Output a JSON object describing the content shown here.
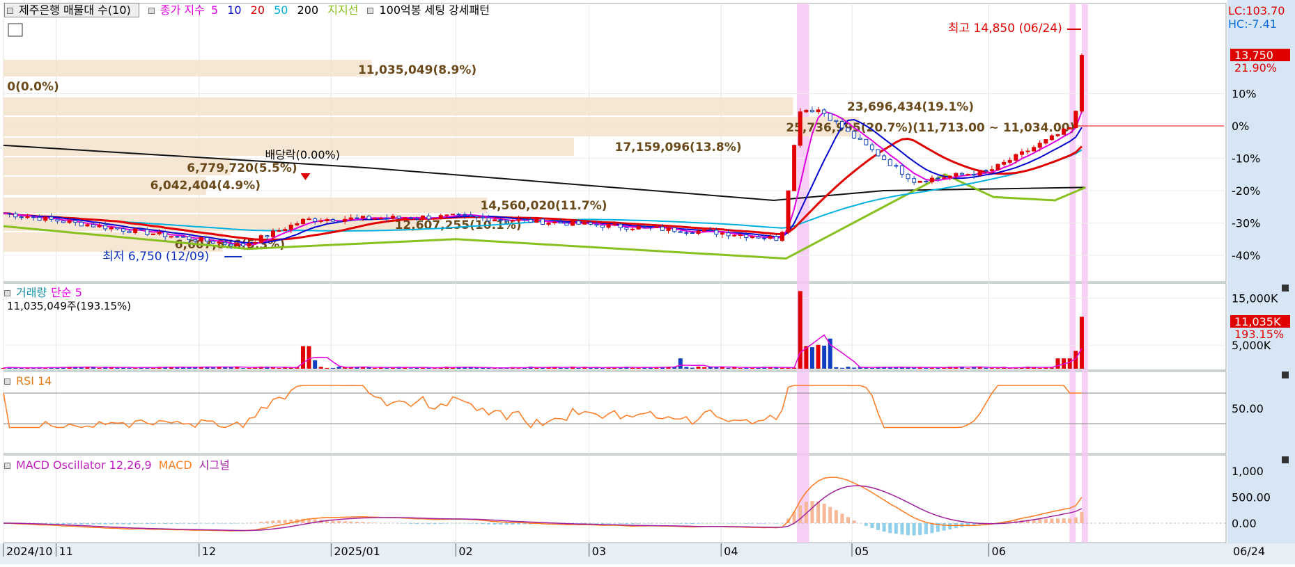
{
  "header": {
    "stock_button": "제주은행 매물대 수(10)",
    "price_indicator": "종가 지수",
    "ma_periods": [
      "5",
      "10",
      "20",
      "50",
      "200"
    ],
    "ma_colors": [
      "#e000e0",
      "#0000d0",
      "#e00000",
      "#00b0e0",
      "#000000"
    ],
    "envelope_label": "지지선",
    "envelope_color": "#88c020",
    "pattern_label": "100억봉 세팅 강세패턴"
  },
  "price_panel": {
    "lc_label": "LC:103.70",
    "hc_label": "HC:-7.41",
    "current_price_label": "13,750",
    "current_pct_label": "21.90%",
    "high_marker": "최고 14,850 (06/24)",
    "low_marker": "최저 6,750 (12/09)",
    "dividend_marker": "배당락(0.00%)",
    "pct_axis": [
      "10%",
      "0%",
      "-10%",
      "-20%",
      "-30%",
      "-40%"
    ],
    "volume_profile": [
      {
        "label": "11,035,049(8.9%)"
      },
      {
        "label": "0(0.0%)"
      },
      {
        "label": "23,696,434(19.1%)"
      },
      {
        "label": "25,736,995(20.7%)(11,713.00 ~ 11,034.00)"
      },
      {
        "label": "17,159,096(13.8%)"
      },
      {
        "label": "6,779,720(5.5%)"
      },
      {
        "label": "6,042,404(4.9%)"
      },
      {
        "label": "14,560,020(11.7%)"
      },
      {
        "label": "12,607,255(10.1%)"
      },
      {
        "label": "6,607,876(5.3%)"
      }
    ]
  },
  "volume_panel": {
    "title": "거래량",
    "ma_label": "단순 5",
    "value_label": "11,035,049주(193.15%)",
    "axis": [
      "15,000K",
      "5,000K"
    ],
    "current_label": "11,035K",
    "current_pct": "193.15%"
  },
  "rsi_panel": {
    "title": "RSI 14",
    "axis": [
      "50.00"
    ]
  },
  "macd_panel": {
    "osc_label": "MACD Oscillator 12,26,9",
    "macd_label": "MACD",
    "signal_label": "시그널",
    "axis": [
      "1,000",
      "500.00",
      "0.00"
    ]
  },
  "x_axis": {
    "labels": [
      "2024/10",
      "11",
      "12",
      "2025/01",
      "02",
      "03",
      "04",
      "05",
      "06"
    ],
    "current_date": "06/24"
  },
  "chart_data": {
    "type": "candlestick",
    "title": "",
    "x_axis": "date (daily, 2024/10 ~ 06/24)",
    "y_axis_primary": "price change % (-40% ~ 10%)",
    "ylim_pct": [
      -40,
      10
    ],
    "key_points": [
      {
        "date": "2024/10",
        "close_pct": -27
      },
      {
        "date": "2024/12/09",
        "low_price": 6750,
        "close_pct": -37
      },
      {
        "date": "2024/12/27",
        "event": "dividend ex-date",
        "close_pct": -29
      },
      {
        "date": "2025/02",
        "close_pct": -28
      },
      {
        "date": "2025/04",
        "close_pct": -33
      },
      {
        "date": "2025/04/17",
        "close_pct": -35
      },
      {
        "date": "2025/04/22",
        "close_pct": 5
      },
      {
        "date": "2025/04/28",
        "high_pct": 22,
        "close_pct": 5
      },
      {
        "date": "2025/05",
        "close_pct": -3
      },
      {
        "date": "2025/05/20",
        "close_pct": -17
      },
      {
        "date": "2025/06",
        "close_pct": -14
      },
      {
        "date": "2025/06/23",
        "close_pct": 0
      },
      {
        "date": "2025/06/24",
        "close": 13750,
        "close_pct": 21.9,
        "high": 14850
      }
    ],
    "volume_profile_pct": [
      8.9,
      0.0,
      19.1,
      20.7,
      13.8,
      5.5,
      4.9,
      11.7,
      10.1,
      5.3
    ],
    "volume_latest": 11035049,
    "volume_latest_pct": 193.15,
    "rsi_reference": 50,
    "macd_params": [
      12,
      26,
      9
    ]
  }
}
